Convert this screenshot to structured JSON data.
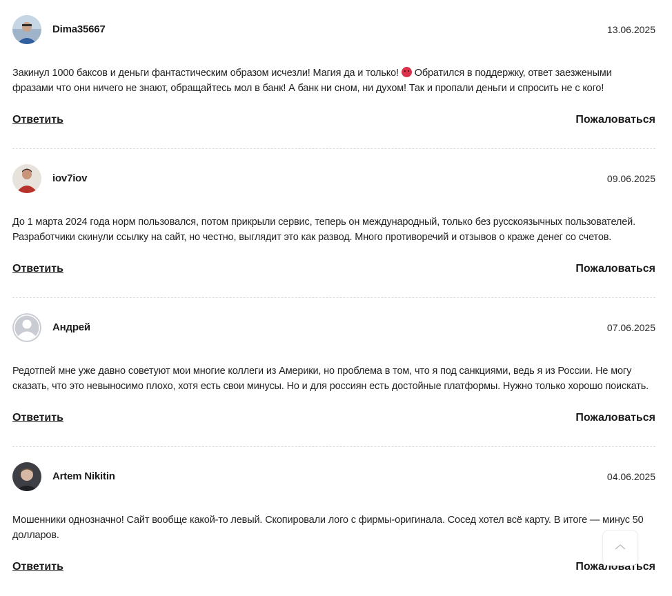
{
  "comments": [
    {
      "author": "Dima35667",
      "date": "13.06.2025",
      "text_before_emoji": "Закинул 1000 баксов и деньги фантастическим образом исчезли! Магия да и только! ",
      "has_emoji": true,
      "emoji": "angry-face-icon",
      "text_after_emoji": " Обратился в поддержку, ответ заезжеными фразами что они ничего не знают, обращайтесь мол в банк! А банк ни сном, ни духом! Так и пропали деньги и спросить не с кого!",
      "reply_label": "Ответить",
      "report_label": "Пожаловаться",
      "avatar": "photo-avatar-blue"
    },
    {
      "author": "iov7iov",
      "date": "09.06.2025",
      "text_before_emoji": "До 1 марта 2024 года норм пользовался, потом прикрыли сервис, теперь он международный, только без русскоязычных пользователей. Разработчики скинули ссылку на сайт, но честно, выглядит это как развод. Много противоречий и отзывов о краже денег со счетов.",
      "has_emoji": false,
      "text_after_emoji": "",
      "reply_label": "Ответить",
      "report_label": "Пожаловаться",
      "avatar": "photo-avatar-red"
    },
    {
      "author": "Андрей",
      "date": "07.06.2025",
      "text_before_emoji": "Редотпей мне уже давно советуют мои многие коллеги из Америки, но проблема в том, что я под санкциями, ведь я из России. Не могу сказать, что это невыносимо плохо, хотя есть свои минусы. Но и для россиян есть достойные платформы. Нужно только хорошо поискать.",
      "has_emoji": false,
      "text_after_emoji": "",
      "reply_label": "Ответить",
      "report_label": "Пожаловаться",
      "avatar": "default-avatar"
    },
    {
      "author": "Artem Nikitin",
      "date": "04.06.2025",
      "text_before_emoji": "Мошенники однозначно! Сайт вообще какой-то левый. Скопировали лого с фирмы-оригинала. Сосед хотел всё карту. В итоге — минус 50 долларов.",
      "has_emoji": false,
      "text_after_emoji": "",
      "reply_label": "Ответить",
      "report_label": "Пожаловаться",
      "avatar": "photo-avatar-dark"
    }
  ],
  "scroll_top": {
    "icon": "chevron-up-icon"
  },
  "colors": {
    "text": "#1b1b1b",
    "divider": "#dcdcdc",
    "emoji": "#d9324a",
    "default_avatar": "#c9ccd2"
  }
}
